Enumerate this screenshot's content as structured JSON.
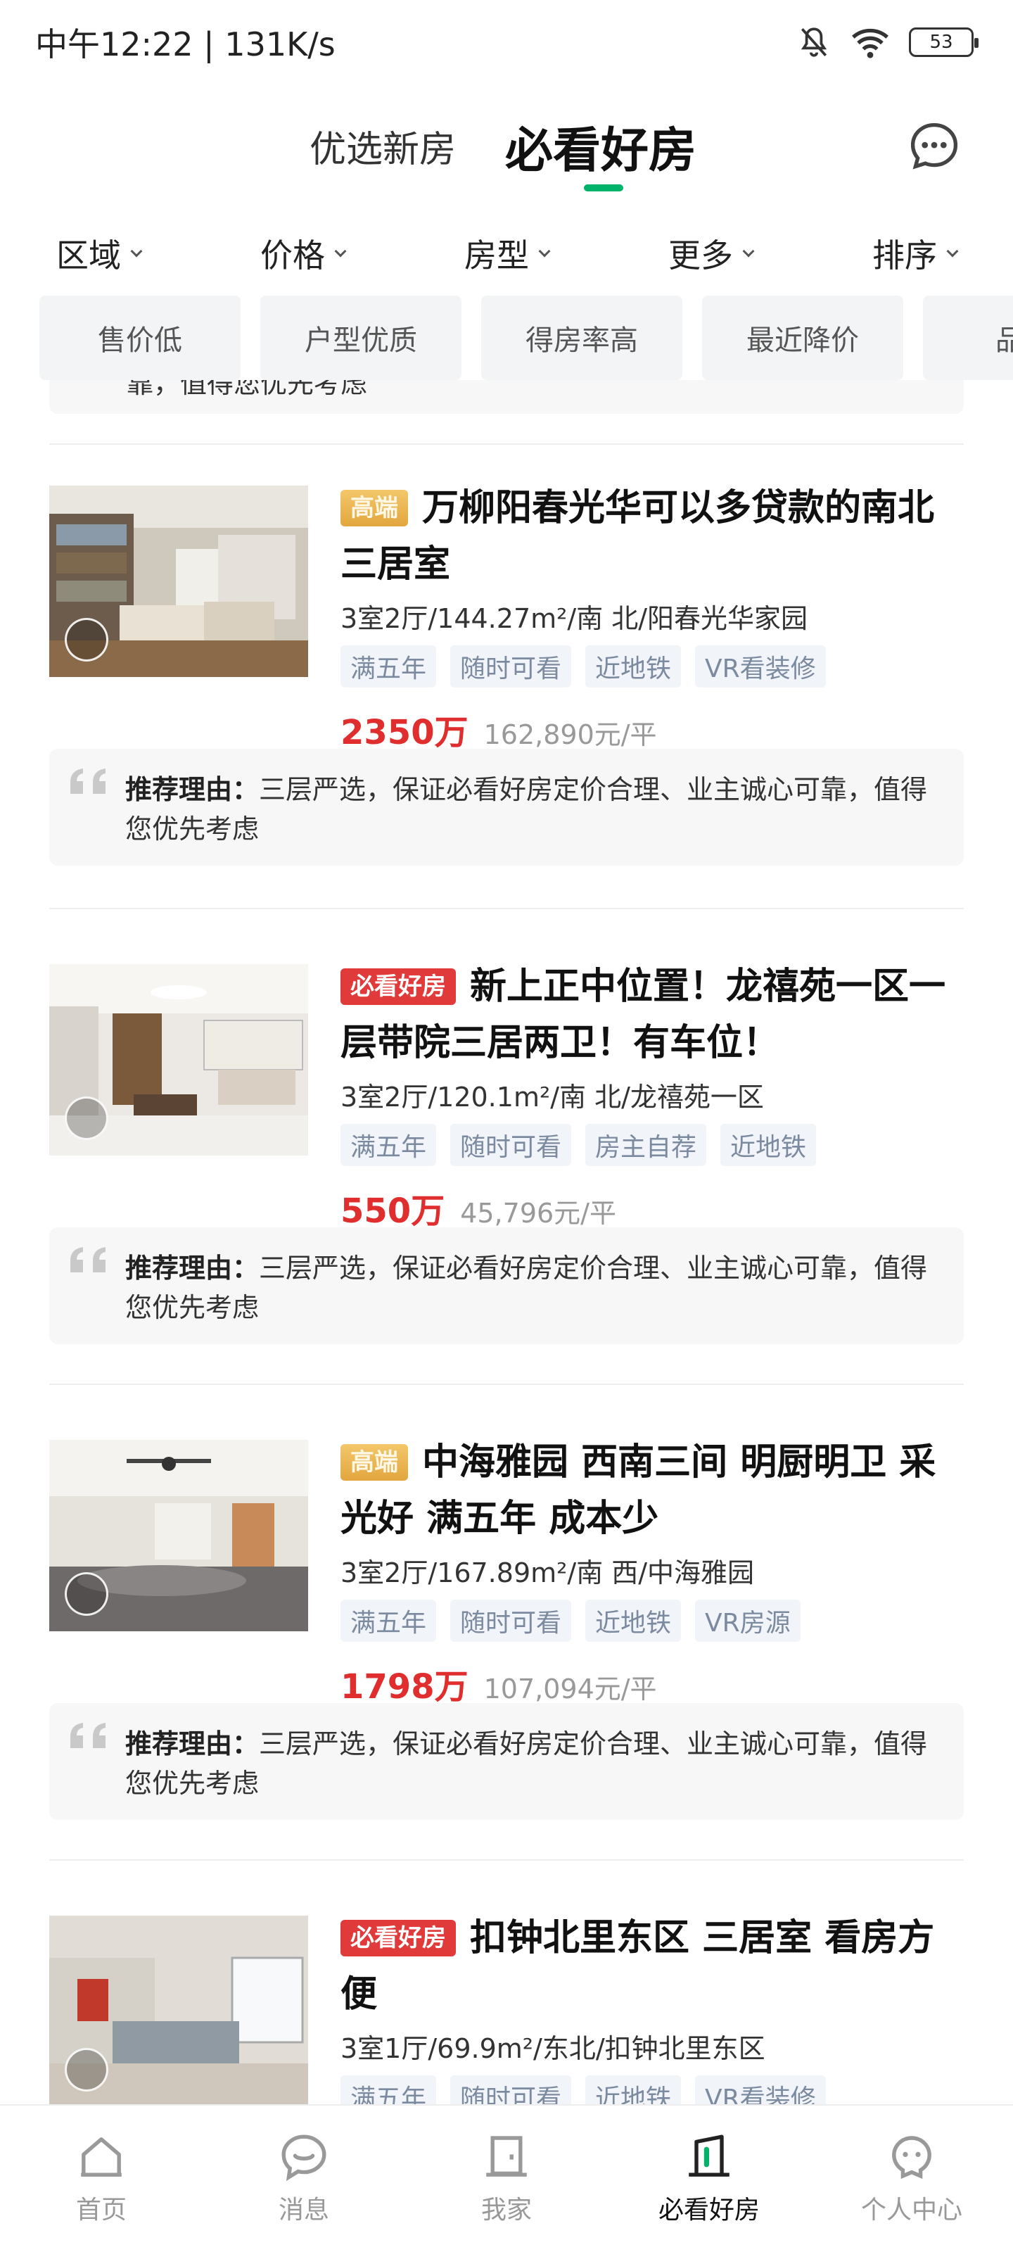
{
  "status_bar": {
    "time_speed": "中午12:22 | 131K/s",
    "battery": "53"
  },
  "header": {
    "tab_secondary": "优选新房",
    "tab_active": "必看好房"
  },
  "filters": [
    {
      "label": "区域"
    },
    {
      "label": "价格"
    },
    {
      "label": "房型"
    },
    {
      "label": "更多"
    },
    {
      "label": "排序"
    }
  ],
  "chips": [
    "售价低",
    "户型优质",
    "得房率高",
    "最近降价",
    "品质"
  ],
  "partial_reason": "靠，值得您优先考虑",
  "listings": [
    {
      "badge": "高端",
      "title": "万柳阳春光华可以多贷款的南北三居室",
      "spec": "3室2厅/144.27m²/南 北/阳春光华家园",
      "tags": [
        "满五年",
        "随时可看",
        "近地铁",
        "VR看装修"
      ],
      "price": "2350万",
      "unit_price": "162,890元/平",
      "reason_label": "推荐理由：",
      "reason": "三层严选，保证必看好房定价合理、业主诚心可靠，值得您优先考虑"
    },
    {
      "badge": "必看好房",
      "title": "新上正中位置！龙禧苑一区一层带院三居两卫！有车位！",
      "spec": "3室2厅/120.1m²/南 北/龙禧苑一区",
      "tags": [
        "满五年",
        "随时可看",
        "房主自荐",
        "近地铁"
      ],
      "price": "550万",
      "unit_price": "45,796元/平",
      "reason_label": "推荐理由：",
      "reason": "三层严选，保证必看好房定价合理、业主诚心可靠，值得您优先考虑"
    },
    {
      "badge": "高端",
      "title": "中海雅园 西南三间 明厨明卫 采光好 满五年 成本少",
      "spec": "3室2厅/167.89m²/南 西/中海雅园",
      "tags": [
        "满五年",
        "随时可看",
        "近地铁",
        "VR房源"
      ],
      "price": "1798万",
      "unit_price": "107,094元/平",
      "reason_label": "推荐理由：",
      "reason": "三层严选，保证必看好房定价合理、业主诚心可靠，值得您优先考虑"
    },
    {
      "badge": "必看好房",
      "title": "扣钟北里东区 三居室 看房方便",
      "spec": "3室1厅/69.9m²/东北/扣钟北里东区",
      "tags": [
        "满五年",
        "随时可看",
        "近地铁",
        "VR看装修"
      ]
    }
  ],
  "bottom_nav": [
    {
      "label": "首页",
      "icon": "home-icon"
    },
    {
      "label": "消息",
      "icon": "chat-bubble-icon"
    },
    {
      "label": "我家",
      "icon": "door-icon"
    },
    {
      "label": "必看好房",
      "icon": "building-icon"
    },
    {
      "label": "个人中心",
      "icon": "profile-icon"
    }
  ],
  "colors": {
    "accent_green": "#00b36b",
    "price_red": "#e02d2d",
    "badge_red": "#e03a3a",
    "badge_gold": "#e2a63e"
  }
}
